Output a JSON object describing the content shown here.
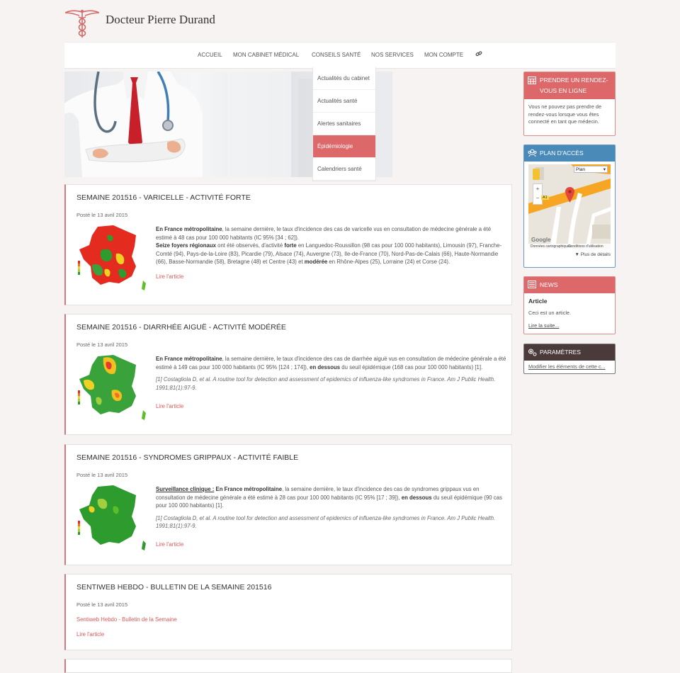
{
  "header": {
    "site_title": "Docteur Pierre Durand"
  },
  "nav": {
    "items": [
      "Accueil",
      "Mon cabinet médical",
      "Conseils santé",
      "Nos services",
      "Mon compte"
    ]
  },
  "dropdown": {
    "items": [
      "Actualités du cabinet",
      "Actualités santé",
      "Alertes sanitaires",
      "Épidémiologie",
      "Calendriers santé"
    ],
    "active_index": 3
  },
  "articles": [
    {
      "title": "Semaine 201516 - Varicelle - Activité forte",
      "date": "Posté le 13 avril 2015",
      "p1_b": "En France métropolitaine",
      "p1": ", la semaine dernière, le taux d'incidence des cas de varicelle vus en consultation de médecine générale a été estimé à 48 cas pour 100 000 habitants (IC 95% [34 ; 62]).",
      "p2_b": "Seize foyers régionaux",
      "p2a": " ont été observés, d'activité ",
      "p2_b2": "forte",
      "p2b": " en Languedoc-Roussillon (98 cas pour 100 000 habitants), Limousin (97), Franche-Comté (94), Pays-de-la-Loire (83), Picardie (79), Alsace (74), Auvergne (73), Ile-de-France (70), Nord-Pas-de-Calais (66), Haute-Normandie (66), Basse-Normandie (58), Bretagne (48) et Centre (43) et ",
      "p2_b3": "modérée",
      "p2c": " en Rhône-Alpes (25), Lorraine (24) et Corse (24).",
      "link": "Lire l'article"
    },
    {
      "title": "Semaine 201516 - Diarrhée aiguë - Activité modérée",
      "date": "Posté le 13 avril 2015",
      "p1_b": "En France métropolitaine",
      "p1": ", la semaine dernière, le taux d'incidence des cas de diarrhée aiguë vus en consultation de médecine générale a été estimé à 149 cas pour 100 000 habitants (IC 95% [124 ; 174]), ",
      "p1_b2": "en dessous",
      "p1c": " du seuil épidémique (168 cas pour 100 000 habitants) [1].",
      "ref": "[1] Costagliola D, et al. A routine tool for detection and assessment of epidemics of influenza-like syndromes in France. Am J Public Health. 1991;81(1):97-9.",
      "link": "Lire l'article"
    },
    {
      "title": "Semaine 201516 - Syndromes grippaux - Activité faible",
      "date": "Posté le 13 avril 2015",
      "p0_u": "Surveillance clinique :",
      "p1_b": " En France métropolitaine",
      "p1": ", la semaine dernière, le taux d'incidence des cas de syndromes grippaux vus en consultation de médecine générale a été estimé à 28 cas pour 100 000 habitants (IC 95% [17 ; 39]), ",
      "p1_b2": "en dessous",
      "p1c": " du seuil épidémique (90 cas pour 100 000 habitants) [1].",
      "ref": "[1] Costagliola D, et al. A routine tool for detection and assessment of epidemics of influenza-like syndromes in France. Am J Public Health. 1991;81(1):97-9.",
      "link": "Lire l'article"
    },
    {
      "title": "Sentiweb Hebdo - Bulletin de la semaine 201516",
      "date": "Posté le 13 avril 2015",
      "sub_link": "Sentiweb Hebdo - Bulletin de la Semaine",
      "link": "Lire l'article"
    }
  ],
  "sidebar": {
    "rdv": {
      "title": "Prendre un rendez-vous en ligne",
      "text": "Vous ne pouvez pas prendre de rendez-vous lorsque vous êtes connecté en tant que médecin."
    },
    "plan": {
      "title": "Plan d'accès",
      "map_type": "Plan",
      "footer_left": "Données cartographiques",
      "footer_right": "Conditions d'utilisation",
      "details": "▼ Plus de détails",
      "google": "Google",
      "road_label": "A1"
    },
    "news": {
      "title": "News",
      "article_title": "Article",
      "text": "Ceci est un article.",
      "link": "Lire la suite..."
    },
    "params": {
      "title": "Paramètres",
      "link": "Modifier les éléments de cette c..."
    }
  },
  "colors": {
    "accent": "#dd6869",
    "plan_header": "#4a8ab8",
    "params_header": "#4a3a3a"
  }
}
